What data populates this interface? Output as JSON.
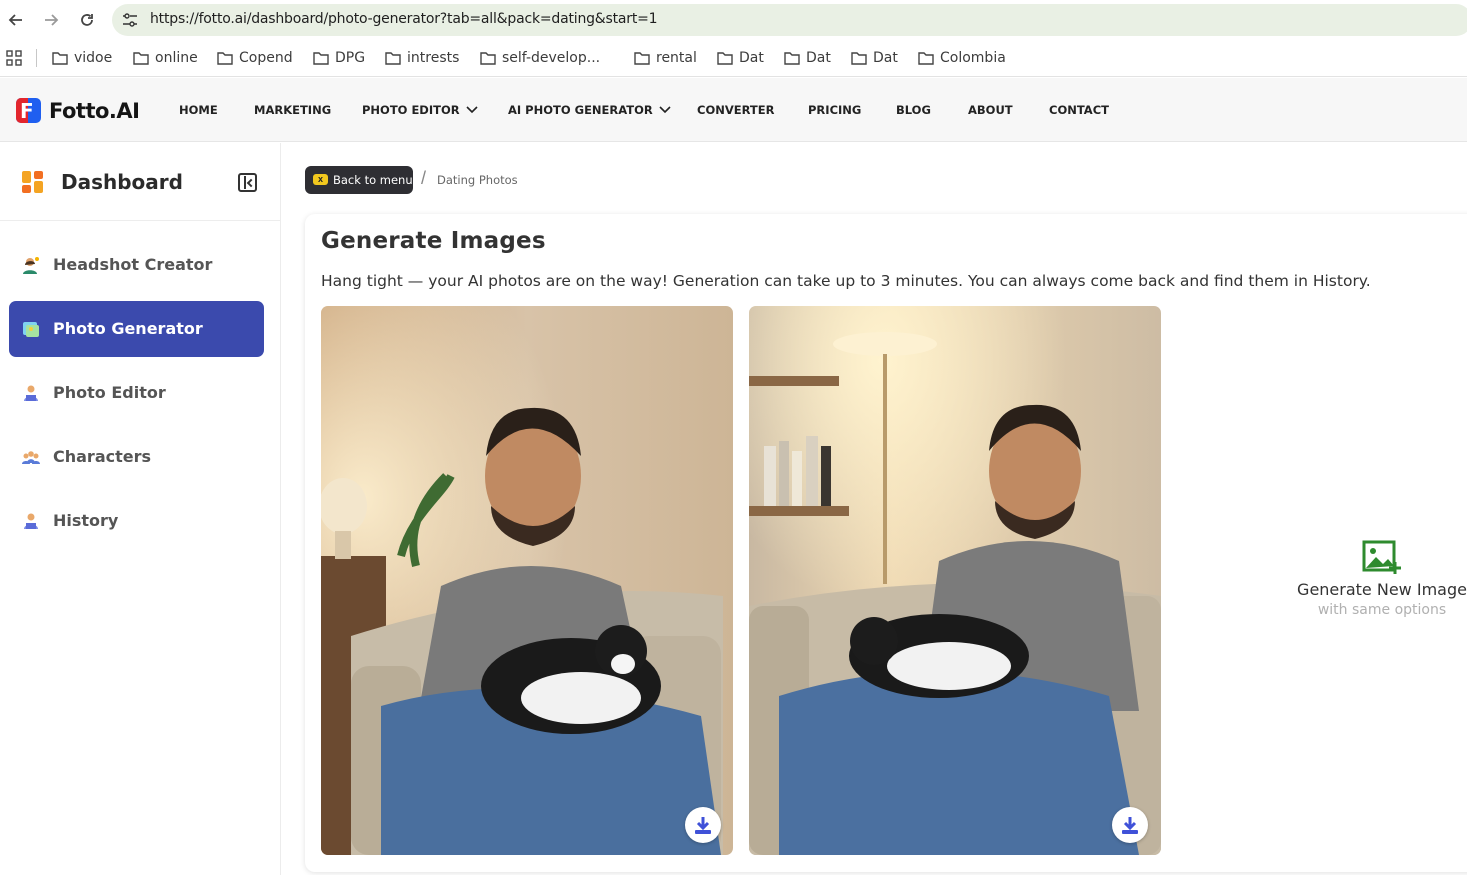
{
  "browser": {
    "url": "https://fotto.ai/dashboard/photo-generator?tab=all&pack=dating&start=1",
    "bookmarks": [
      "vidoe",
      "online",
      "Copend",
      "DPG",
      "intrests",
      "self-develop...",
      "rental",
      "Dat",
      "Dat",
      "Dat",
      "Colombia"
    ]
  },
  "site": {
    "logo_text": "Fotto.AI",
    "logo_mark": "F",
    "nav": [
      "HOME",
      "MARKETING",
      "PHOTO EDITOR",
      "AI PHOTO GENERATOR",
      "CONVERTER",
      "PRICING",
      "BLOG",
      "ABOUT",
      "CONTACT"
    ]
  },
  "sidebar": {
    "title": "Dashboard",
    "items": [
      {
        "label": "Headshot Creator",
        "icon": "person-icon"
      },
      {
        "label": "Photo Generator",
        "icon": "image-icon",
        "active": true
      },
      {
        "label": "Photo Editor",
        "icon": "photo-editor-icon"
      },
      {
        "label": "Characters",
        "icon": "group-icon"
      },
      {
        "label": "History",
        "icon": "history-icon"
      }
    ]
  },
  "breadcrumb": {
    "back_label": "Back to menu",
    "back_icon": "x",
    "current": "Dating Photos"
  },
  "main": {
    "title": "Generate Images",
    "subtitle": "Hang tight — your AI photos are on the way! Generation can take up to 3 minutes. You can always come back and find them in History.",
    "generate_new": {
      "label": "Generate New Image",
      "sublabel": "with same options"
    }
  },
  "colors": {
    "accent": "#3b4aad",
    "generate_icon": "#2e8b2e",
    "download_icon": "#3f51d8"
  }
}
